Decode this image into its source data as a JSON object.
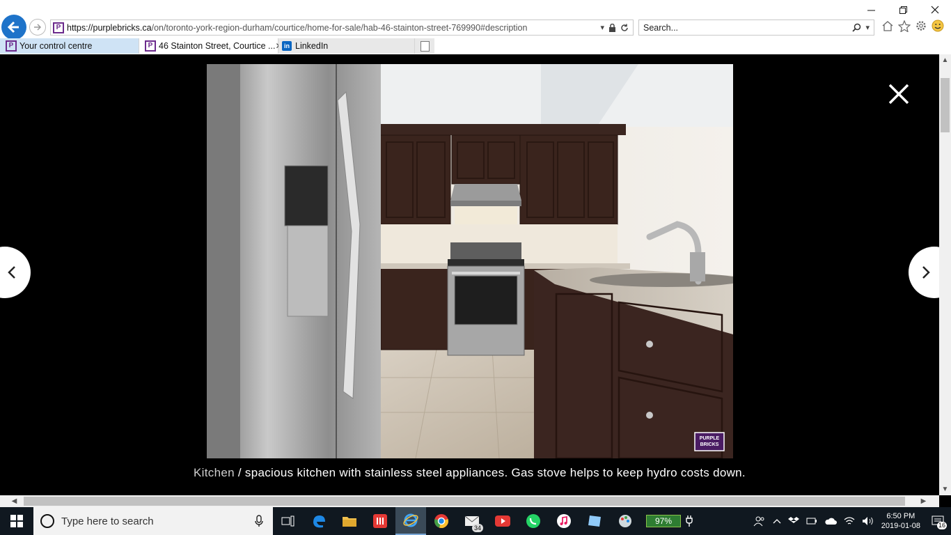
{
  "browser": {
    "url_host": "https://purplebricks.ca",
    "url_path": "/on/toronto-york-region-durham/courtice/home-for-sale/hab-46-stainton-street-769990#description",
    "search_placeholder": "Search...",
    "tabs": [
      {
        "label": "Your control centre",
        "icon": "purplebricks-favicon"
      },
      {
        "label": "46 Stainton Street, Courtice ...",
        "icon": "purplebricks-favicon"
      },
      {
        "label": "LinkedIn",
        "icon": "linkedin-icon"
      }
    ],
    "favicon_letter": "P"
  },
  "lightbox": {
    "caption_room": "Kitchen",
    "caption_text": " / spacious kitchen with stainless steel appliances. Gas stove helps to keep hydro costs down.",
    "watermark_line1": "PURPLE",
    "watermark_line2": "BRICKS"
  },
  "taskbar": {
    "search_placeholder": "Type here to search",
    "mail_badge": "34",
    "battery": "97%",
    "time": "6:50 PM",
    "date": "2019-01-08",
    "notifications": "16"
  },
  "colors": {
    "brand_purple": "#6b2a8c",
    "ie_blue": "#1e73c9",
    "taskbar": "#101820"
  }
}
